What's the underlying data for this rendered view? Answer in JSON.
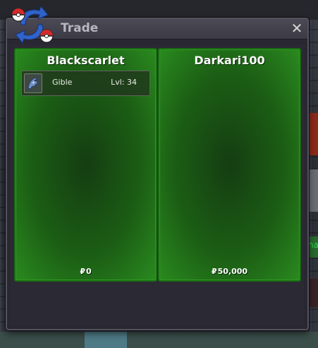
{
  "window": {
    "title": "Trade",
    "close_label": "✕"
  },
  "background": {
    "side_text": "na"
  },
  "trade": {
    "left": {
      "player": "Blackscarlet",
      "currency_symbol": "₽",
      "money": "0",
      "items": [
        {
          "name": "Gible",
          "level": "Lvl: 34",
          "icon": "gible-icon"
        }
      ]
    },
    "right": {
      "player": "Darkari100",
      "currency_symbol": "₽",
      "money": "50,000",
      "items": []
    }
  },
  "colors": {
    "panel_green": "#1b5d14",
    "panel_border": "#1a6b13",
    "window_bg": "#292732",
    "titlebar": "#44424d",
    "title_text": "#b7b6bf"
  }
}
